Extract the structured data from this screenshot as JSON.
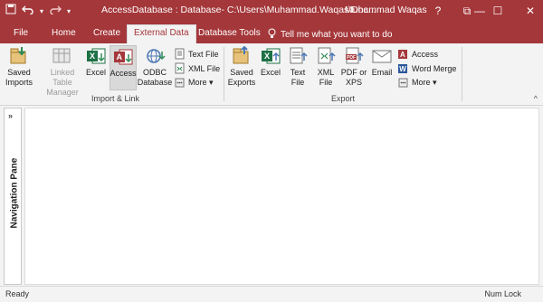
{
  "titlebar": {
    "title": "AccessDatabase : Database- C:\\Users\\Muhammad.Waqas\\Doc...",
    "user": "Muhammad Waqas",
    "help": "?",
    "restore": "⧉",
    "minimize": "—",
    "maximize": "☐",
    "close": "✕"
  },
  "tabs": {
    "file": "File",
    "home": "Home",
    "create": "Create",
    "external_data": "External Data",
    "database_tools": "Database Tools",
    "tell_me": "Tell me what you want to do"
  },
  "ribbon": {
    "import_link": {
      "saved_imports": "Saved Imports",
      "linked_table_manager": "Linked Table Manager",
      "excel": "Excel",
      "access": "Access",
      "odbc": "ODBC Database",
      "text_file": "Text File",
      "xml_file": "XML File",
      "more": "More ▾",
      "label": "Import & Link"
    },
    "export": {
      "saved_exports": "Saved Exports",
      "excel": "Excel",
      "text_file": "Text File",
      "xml_file": "XML File",
      "pdf_xps": "PDF or XPS",
      "email": "Email",
      "access": "Access",
      "word_merge": "Word Merge",
      "more": "More ▾",
      "label": "Export"
    },
    "collapse": "^"
  },
  "nav": {
    "label": "Navigation Pane",
    "chevron": "»"
  },
  "status": {
    "left": "Ready",
    "right": "Num Lock"
  },
  "colors": {
    "accent": "#a4373a",
    "ribbon_bg": "#f3f3f3",
    "excel_green": "#1e7145",
    "access_red": "#a4373a",
    "word_blue": "#2b579a"
  }
}
